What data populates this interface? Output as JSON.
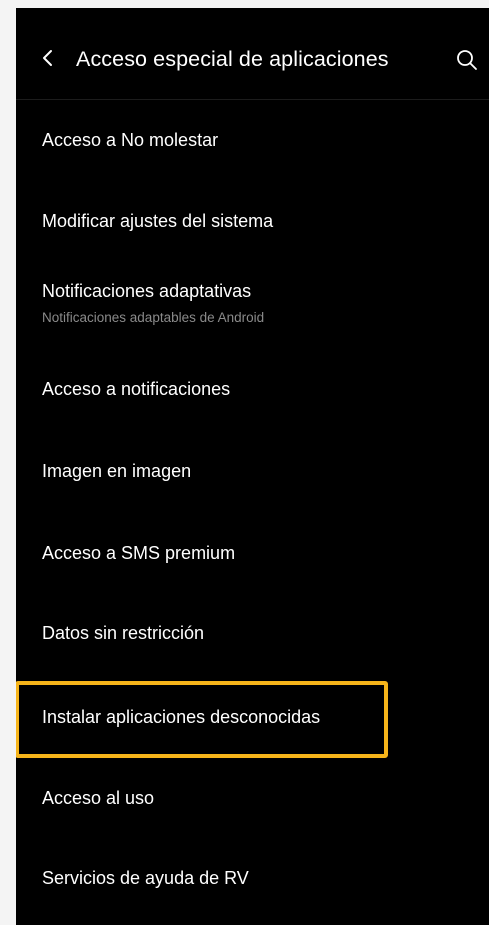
{
  "header": {
    "title": "Acceso especial de aplicaciones",
    "back_icon": "chevron-left-icon",
    "search_icon": "search-icon"
  },
  "list": {
    "items": [
      {
        "title": "Acceso a No molestar"
      },
      {
        "title": "Modificar ajustes del sistema"
      },
      {
        "title": "Notificaciones adaptativas",
        "subtitle": "Notificaciones adaptables de Android"
      },
      {
        "title": "Acceso a notificaciones"
      },
      {
        "title": "Imagen en imagen"
      },
      {
        "title": "Acceso a SMS premium"
      },
      {
        "title": "Datos sin restricción"
      },
      {
        "title": "Instalar aplicaciones desconocidas"
      },
      {
        "title": "Acceso al uso"
      },
      {
        "title": "Servicios de ayuda de RV"
      }
    ]
  },
  "colors": {
    "background": "#000000",
    "text_primary": "#ffffff",
    "text_secondary": "#8a8a8a",
    "highlight": "#f6b41a"
  }
}
